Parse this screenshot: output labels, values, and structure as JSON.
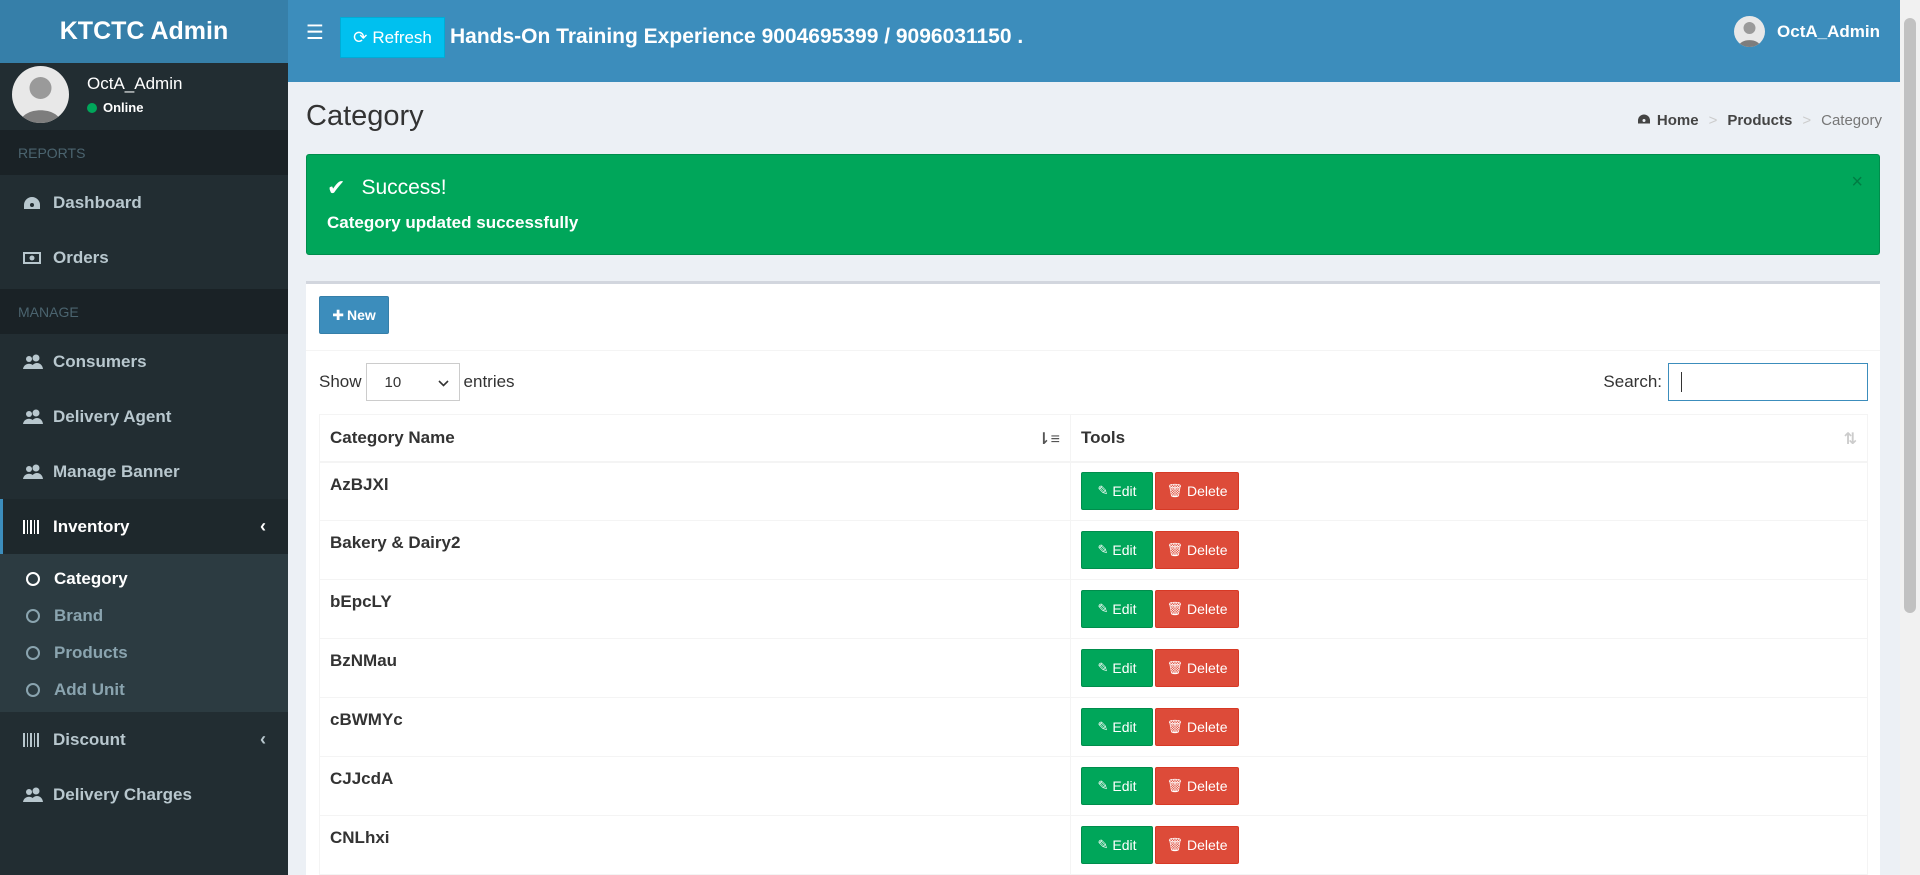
{
  "app": {
    "logo": "KTCTC Admin"
  },
  "user": {
    "name": "OctA_Admin",
    "status": "Online"
  },
  "sidebar": {
    "section_reports": "REPORTS",
    "section_manage": "MANAGE",
    "items": [
      {
        "label": "Dashboard",
        "icon": "dashboard-icon"
      },
      {
        "label": "Orders",
        "icon": "money-icon"
      },
      {
        "label": "Consumers",
        "icon": "users-icon"
      },
      {
        "label": "Delivery Agent",
        "icon": "users-icon"
      },
      {
        "label": "Manage Banner",
        "icon": "users-icon"
      },
      {
        "label": "Inventory",
        "icon": "barcode-icon"
      },
      {
        "label": "Discount",
        "icon": "barcode-icon"
      },
      {
        "label": "Delivery Charges",
        "icon": "users-icon"
      }
    ],
    "inventory_sub": [
      "Category",
      "Brand",
      "Products",
      "Add Unit"
    ]
  },
  "header": {
    "refresh_label": "Refresh",
    "title": "Hands-On Training Experience 9004695399 / 9096031150 .",
    "user_name": "OctA_Admin"
  },
  "page": {
    "title": "Category",
    "breadcrumb": [
      "Home",
      "Products",
      "Category"
    ]
  },
  "alert": {
    "title": "Success!",
    "message": "Category updated successfully",
    "close": "×"
  },
  "box": {
    "new_label": "New",
    "show_label": "Show",
    "entries_value": "10",
    "entries_label": "entries",
    "search_label": "Search:",
    "search_value": ""
  },
  "table": {
    "headers": [
      "Category Name",
      "Tools"
    ],
    "edit_label": "Edit",
    "delete_label": "Delete",
    "rows": [
      "AzBJXl",
      "Bakery & Dairy2",
      "bEpcLY",
      "BzNMau",
      "cBWMYc",
      "CJJcdA",
      "CNLhxi"
    ]
  },
  "colors": {
    "header": "#3c8dbc",
    "sidebar": "#222d32",
    "success": "#00a65a",
    "danger": "#dd4b39",
    "info": "#00c0ef"
  }
}
